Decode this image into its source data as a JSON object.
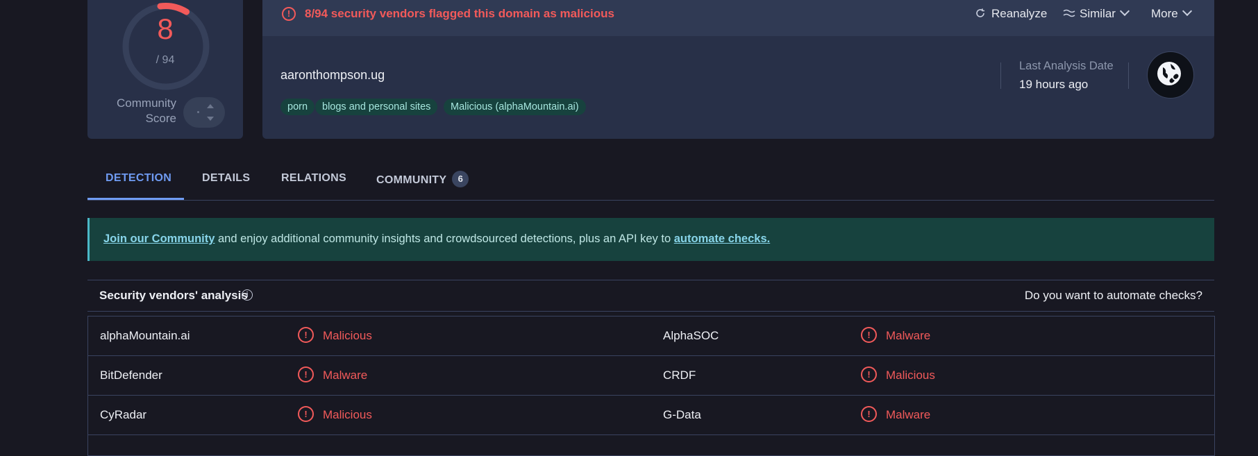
{
  "score": {
    "detections": "8",
    "total": "/ 94",
    "fraction_flagged": 0.085,
    "community_label": "Community Score",
    "colors": {
      "accent": "#f25a5a",
      "track": "#36405a"
    }
  },
  "summary": {
    "alert_text": "8/94 security vendors flagged this domain as malicious",
    "alert_icon": "alert-circle-icon",
    "toolbar": {
      "reanalyze": "Reanalyze",
      "similar": "Similar",
      "more": "More"
    },
    "domain": "aaronthompson.ug",
    "tags": [
      "porn",
      "blogs and personal sites",
      "Malicious (alphaMountain.ai)"
    ],
    "last_analysis_label": "Last Analysis Date",
    "last_analysis_value": "19 hours ago",
    "entity_icon": "globe-link-icon"
  },
  "tabs": [
    {
      "label": "DETECTION",
      "active": true
    },
    {
      "label": "DETAILS",
      "active": false
    },
    {
      "label": "RELATIONS",
      "active": false
    },
    {
      "label": "COMMUNITY",
      "active": false,
      "badge": "6"
    }
  ],
  "banner": {
    "link1": "Join our Community",
    "middle": " and enjoy additional community insights and crowdsourced detections, plus an API key to ",
    "link2": "automate checks."
  },
  "vendors": {
    "title": "Security vendors' analysis",
    "automate_question": "Do you want to automate checks?",
    "rows": [
      {
        "left": {
          "vendor": "alphaMountain.ai",
          "result": "Malicious"
        },
        "right": {
          "vendor": "AlphaSOC",
          "result": "Malware"
        }
      },
      {
        "left": {
          "vendor": "BitDefender",
          "result": "Malware"
        },
        "right": {
          "vendor": "CRDF",
          "result": "Malicious"
        }
      },
      {
        "left": {
          "vendor": "CyRadar",
          "result": "Malicious"
        },
        "right": {
          "vendor": "G-Data",
          "result": "Malware"
        }
      }
    ]
  },
  "colors": {
    "background": "#181822",
    "card": "#283048",
    "danger": "#f25a5a",
    "accent_tab": "#6f9bf2",
    "tag_bg": "#17423e"
  }
}
